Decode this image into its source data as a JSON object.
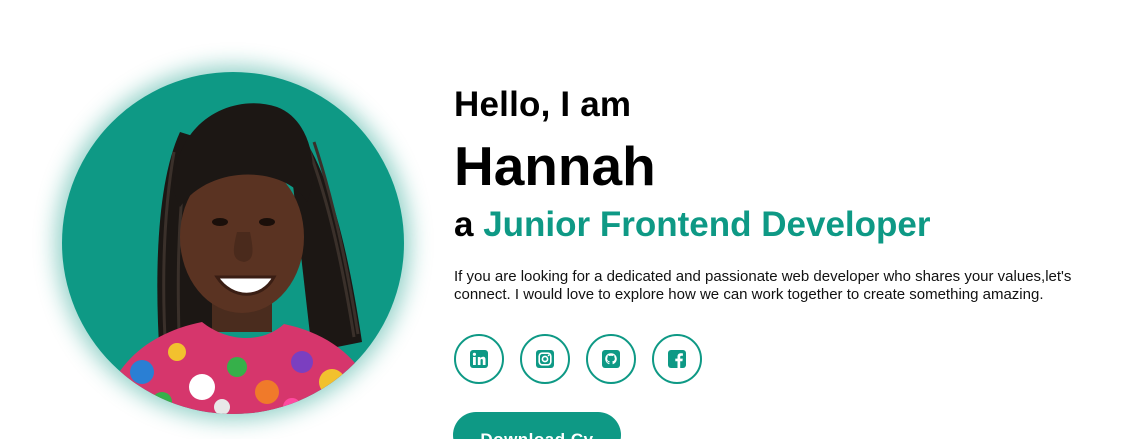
{
  "hero": {
    "greeting": "Hello, I am",
    "name": "Hannah",
    "role_prefix": "a",
    "role": "Junior Frontend Developer",
    "bio": "If you are looking for a dedicated and passionate web developer who shares your values,let's connect. I would love to explore how we can work together to create something amazing.",
    "download_label": "Download Cv"
  },
  "social": [
    {
      "icon": "linkedin-icon"
    },
    {
      "icon": "instagram-icon"
    },
    {
      "icon": "github-icon"
    },
    {
      "icon": "facebook-icon"
    }
  ],
  "colors": {
    "accent": "#0e9985",
    "background": "#ffffff",
    "text": "#000000"
  }
}
